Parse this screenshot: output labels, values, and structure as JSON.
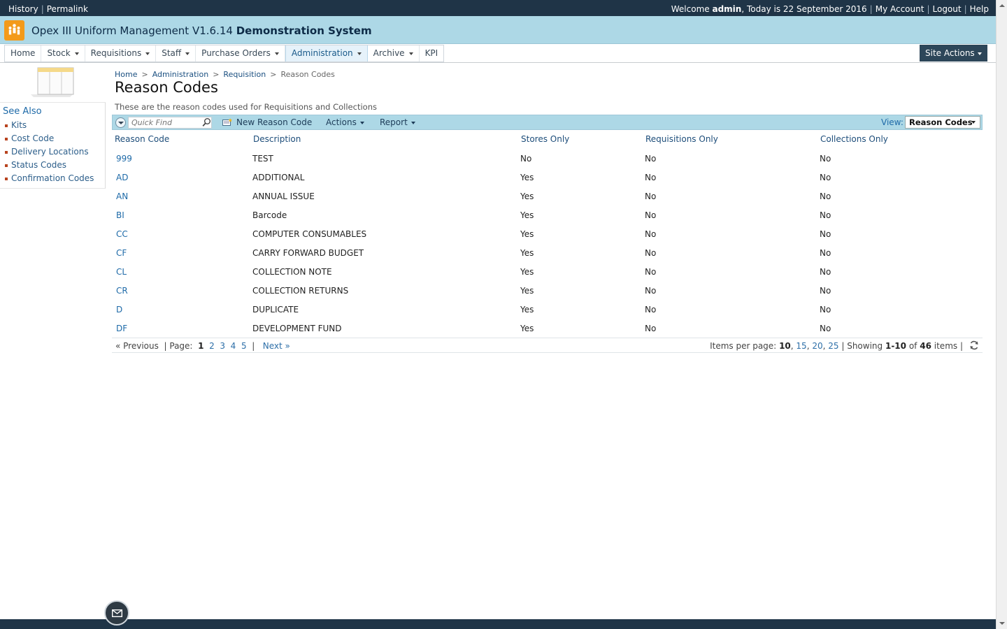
{
  "topbar": {
    "history": "History",
    "permalink": "Permalink",
    "welcome_prefix": "Welcome ",
    "user": "admin",
    "welcome_suffix": ", Today is 22 September 2016",
    "my_account": "My Account",
    "logout": "Logout",
    "help": "Help",
    "sep": "|"
  },
  "app": {
    "title": "Opex III Uniform Management V1.6.14",
    "system": "Demonstration System"
  },
  "nav": {
    "items": [
      {
        "label": "Home"
      },
      {
        "label": "Stock"
      },
      {
        "label": "Requisitions"
      },
      {
        "label": "Staff"
      },
      {
        "label": "Purchase Orders"
      },
      {
        "label": "Administration"
      },
      {
        "label": "Archive"
      },
      {
        "label": "KPI"
      }
    ],
    "site_actions": "Site Actions"
  },
  "sidebar": {
    "heading": "See Also",
    "links": [
      "Kits",
      "Cost Code",
      "Delivery Locations",
      "Status Codes",
      "Confirmation Codes"
    ]
  },
  "breadcrumb": {
    "items": [
      "Home",
      "Administration",
      "Requisition"
    ],
    "current": "Reason Codes",
    "sep": ">"
  },
  "page": {
    "title": "Reason Codes",
    "description": "These are the reason codes used for Requisitions and Collections"
  },
  "toolbar": {
    "quick_find_placeholder": "Quick Find",
    "new_label": "New Reason Code",
    "actions_label": "Actions",
    "report_label": "Report",
    "view_label": "View:",
    "view_value": "Reason Codes"
  },
  "table": {
    "columns": [
      "Reason Code",
      "Description",
      "Stores Only",
      "Requisitions Only",
      "Collections Only"
    ],
    "rows": [
      {
        "code": "999",
        "description": "TEST",
        "stores": "No",
        "requisitions": "No",
        "collections": "No"
      },
      {
        "code": "AD",
        "description": "ADDITIONAL",
        "stores": "Yes",
        "requisitions": "No",
        "collections": "No"
      },
      {
        "code": "AN",
        "description": "ANNUAL ISSUE",
        "stores": "Yes",
        "requisitions": "No",
        "collections": "No"
      },
      {
        "code": "BI",
        "description": "Barcode",
        "stores": "Yes",
        "requisitions": "No",
        "collections": "No"
      },
      {
        "code": "CC",
        "description": "COMPUTER CONSUMABLES",
        "stores": "Yes",
        "requisitions": "No",
        "collections": "No"
      },
      {
        "code": "CF",
        "description": "CARRY FORWARD BUDGET",
        "stores": "Yes",
        "requisitions": "No",
        "collections": "No"
      },
      {
        "code": "CL",
        "description": "COLLECTION NOTE",
        "stores": "Yes",
        "requisitions": "No",
        "collections": "No"
      },
      {
        "code": "CR",
        "description": "COLLECTION RETURNS",
        "stores": "Yes",
        "requisitions": "No",
        "collections": "No"
      },
      {
        "code": "D",
        "description": "DUPLICATE",
        "stores": "Yes",
        "requisitions": "No",
        "collections": "No"
      },
      {
        "code": "DF",
        "description": "DEVELOPMENT FUND",
        "stores": "Yes",
        "requisitions": "No",
        "collections": "No"
      }
    ]
  },
  "pager": {
    "previous": "« Previous",
    "page_label": "Page:",
    "pages": [
      "1",
      "2",
      "3",
      "4",
      "5"
    ],
    "next": "Next »",
    "items_per_page_label": "Items per page:",
    "sizes": [
      "10",
      "15",
      "20",
      "25"
    ],
    "showing_label": "Showing",
    "range": "1-10",
    "of_label": "of",
    "total": "46",
    "items_label": "items"
  },
  "colors": {
    "header_dark": "#1f3447",
    "title_bar": "#add8e6",
    "link": "#1e6aa8"
  },
  "icons": [
    "app-logo-icon",
    "search-icon",
    "new-item-icon",
    "refresh-icon",
    "mail-icon",
    "page-graphic-icon"
  ]
}
